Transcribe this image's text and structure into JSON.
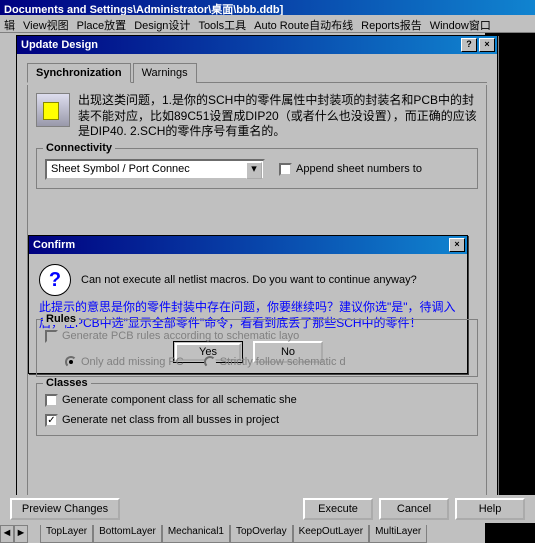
{
  "app_title": "Documents and Settings\\Administrator\\桌面\\bbb.ddb]",
  "menu": [
    "辑",
    "View视图",
    "Place放置",
    "Design设计",
    "Tools工具",
    "Auto Route自动布线",
    "Reports报告",
    "Window窗口"
  ],
  "dialog": {
    "title": "Update Design",
    "help": "?",
    "close": "×",
    "tabs": [
      "Synchronization",
      "Warnings"
    ],
    "info": "出现这类问题，1.是你的SCH中的零件属性中封装项的封装名和PCB中的封装不能对应，比如89C51设置成DIP20（或者什么也没设置），而正确的应该是DIP40.   2.SCH的零件序号有重名的。",
    "group_conn": {
      "title": "Connectivity",
      "select": "Sheet Symbol / Port Connec",
      "append": "Append sheet numbers to"
    },
    "group_rules": {
      "title": "Rules",
      "gen": "Generate PCB rules according to schematic layo",
      "r1": "Only add missing PC",
      "r2": "Strictly follow schematic d"
    },
    "group_classes": {
      "title": "Classes",
      "c1": "Generate component class for all schematic she",
      "c2": "Generate net class from all busses in project"
    }
  },
  "confirm": {
    "title": "Confirm",
    "close": "×",
    "msg": "Can not execute all netlist macros. Do you want to continue anyway?",
    "annot": "此提示的意思是你的零件封装中存在问题，你要继续吗？建议你选\"是\"，待调入后，在PCB中选\"显示全部零件\"命令，看看到底丢了那些SCH中的零件！",
    "yes": "Yes",
    "no": "No"
  },
  "bottom": {
    "preview": "Preview Changes",
    "execute": "Execute",
    "cancel": "Cancel",
    "help": "Help"
  },
  "layers": [
    "TopLayer",
    "BottomLayer",
    "Mechanical1",
    "TopOverlay",
    "KeepOutLayer",
    "MultiLayer"
  ]
}
